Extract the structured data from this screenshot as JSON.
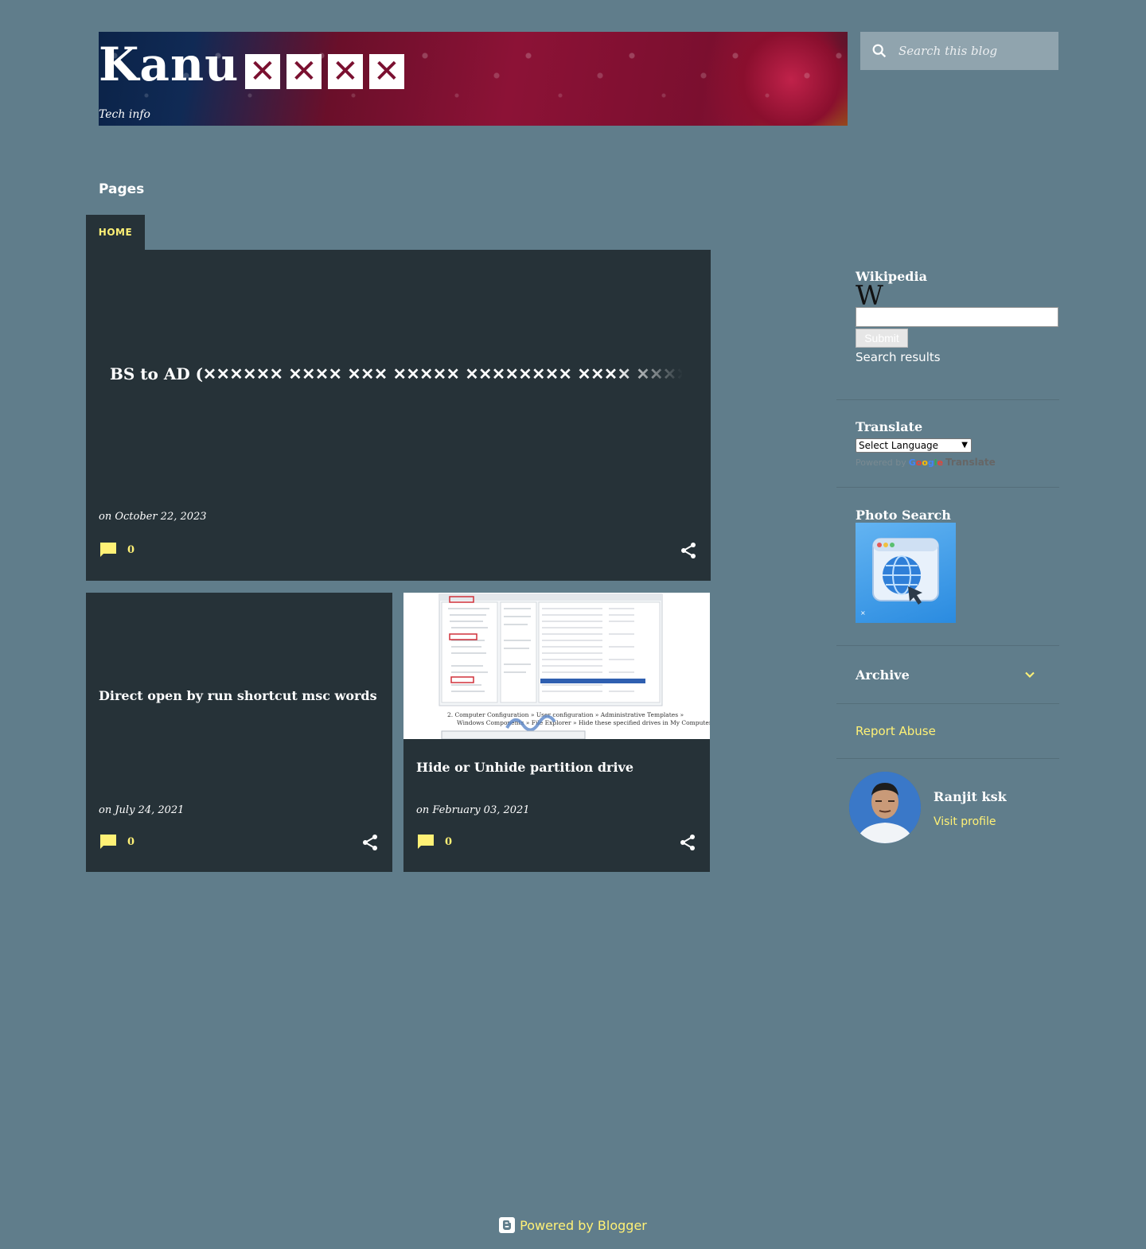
{
  "header": {
    "title": "Kanu",
    "title_glyphs": [
      "✕",
      "✕",
      "✕",
      "✕"
    ],
    "description": "Tech info"
  },
  "search": {
    "placeholder": "Search this blog",
    "icon": "search-icon"
  },
  "pages": {
    "title": "Pages",
    "tabs": [
      {
        "label": "HOME"
      }
    ]
  },
  "posts": [
    {
      "title": "BS to AD (✕✕✕✕✕✕ ✕✕✕✕ ✕✕✕ ✕✕✕✕✕ ✕✕✕✕✕✕✕✕ ✕✕✕✕ ✕✕✕✕✕",
      "date": "on October 22, 2023",
      "comments": "0"
    },
    {
      "title": "Direct open by run shortcut msc words",
      "date": "on July 24, 2021",
      "comments": "0"
    },
    {
      "title": "Hide or Unhide partition drive",
      "date": "on February 03, 2021",
      "comments": "0",
      "thumbnail_caption_1": "2.   Computer Configuration » User configuration » Administrative Templates »",
      "thumbnail_caption_2": "Windows Components » File Explorer » Hide these specified drives in My Computer"
    }
  ],
  "sidebar": {
    "wikipedia": {
      "title": "Wikipedia",
      "logo": "W",
      "submit": "Submit",
      "results": "Search results"
    },
    "translate": {
      "title": "Translate",
      "select": "Select Language",
      "powered": "Powered by",
      "google": [
        "G",
        "o",
        "o",
        "g",
        "l",
        "e"
      ],
      "translate_label": "Translate"
    },
    "photo_search": {
      "title": "Photo Search"
    },
    "archive": {
      "title": "Archive"
    },
    "report": {
      "label": "Report Abuse"
    },
    "profile": {
      "name": "Ranjit ksk",
      "visit": "Visit profile"
    }
  },
  "footer": {
    "label": "Powered by Blogger"
  },
  "colors": {
    "background": "#607d8b",
    "card": "#263238",
    "accent": "#fff176",
    "search_bg": "#90a4ae"
  }
}
